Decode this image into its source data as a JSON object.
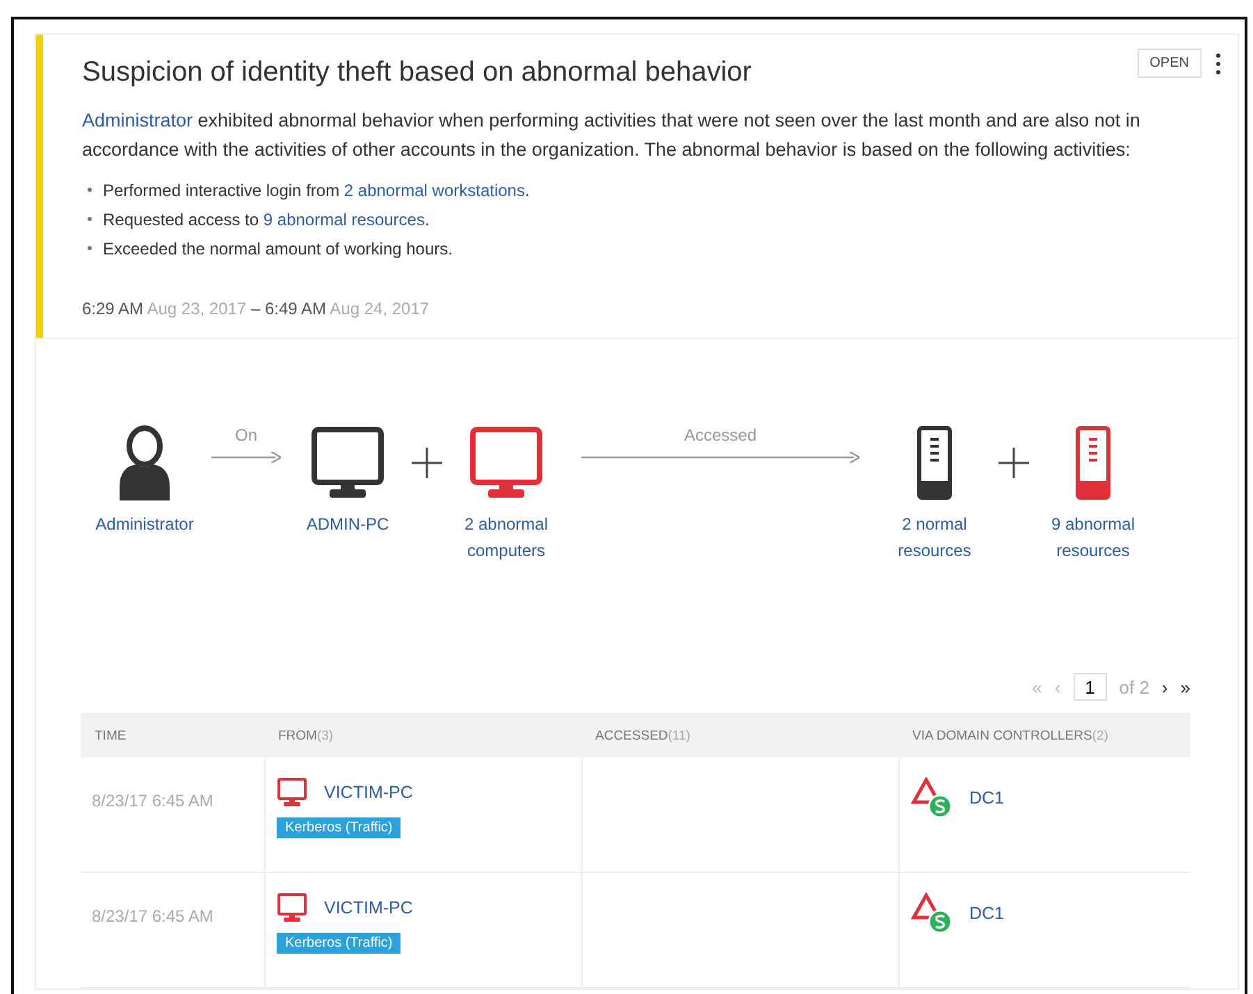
{
  "alert": {
    "title": "Suspicion of identity theft based on abnormal behavior",
    "status": "OPEN",
    "description": {
      "link": "Administrator",
      "text": " exhibited abnormal behavior when performing activities that were not seen over the last month and are also not in accordance with the activities of other accounts in the organization. The abnormal behavior is based on the following activities:"
    },
    "bullets": [
      {
        "before": "Performed interactive login from ",
        "link": "2 abnormal workstations",
        "after": "."
      },
      {
        "before": "Requested access to ",
        "link": "9 abnormal resources",
        "after": "."
      },
      {
        "before": "Exceeded the normal amount of working hours."
      }
    ],
    "time_range": {
      "start_time": "6:29 AM",
      "start_date": "Aug 23, 2017",
      "separator": "–",
      "end_time": "6:49 AM",
      "end_date": "Aug 24, 2017"
    }
  },
  "flow": [
    {
      "kind": "person",
      "label": "Administrator"
    },
    {
      "kind": "arrow",
      "label": "On",
      "long": false
    },
    {
      "kind": "computer",
      "abnormal": false,
      "label": "ADMIN-PC"
    },
    {
      "kind": "plus"
    },
    {
      "kind": "computer",
      "abnormal": true,
      "label": "2 abnormal computers"
    },
    {
      "kind": "arrow",
      "label": "Accessed",
      "long": true
    },
    {
      "kind": "server",
      "abnormal": false,
      "label": "2 normal resources"
    },
    {
      "kind": "plus"
    },
    {
      "kind": "server",
      "abnormal": true,
      "label": "9 abnormal resources"
    }
  ],
  "pagination": {
    "first": "«",
    "previous": "‹",
    "page": "1",
    "of": "of 2",
    "next": "›",
    "last": "»"
  },
  "table": {
    "columns": [
      {
        "label": "TIME"
      },
      {
        "label": "FROM",
        "count": "(3)"
      },
      {
        "label": "ACCESSED",
        "count": "(11)"
      },
      {
        "label": "VIA DOMAIN CONTROLLERS",
        "count": "(2)"
      }
    ],
    "rows": [
      {
        "time": "8/23/17 6:45 AM",
        "from": "VICTIM-PC",
        "tag": "Kerberos (Traffic)",
        "via": "DC1"
      },
      {
        "time": "8/23/17 6:45 AM",
        "from": "VICTIM-PC",
        "tag": "Kerberos (Traffic)",
        "via": "DC1"
      }
    ]
  }
}
